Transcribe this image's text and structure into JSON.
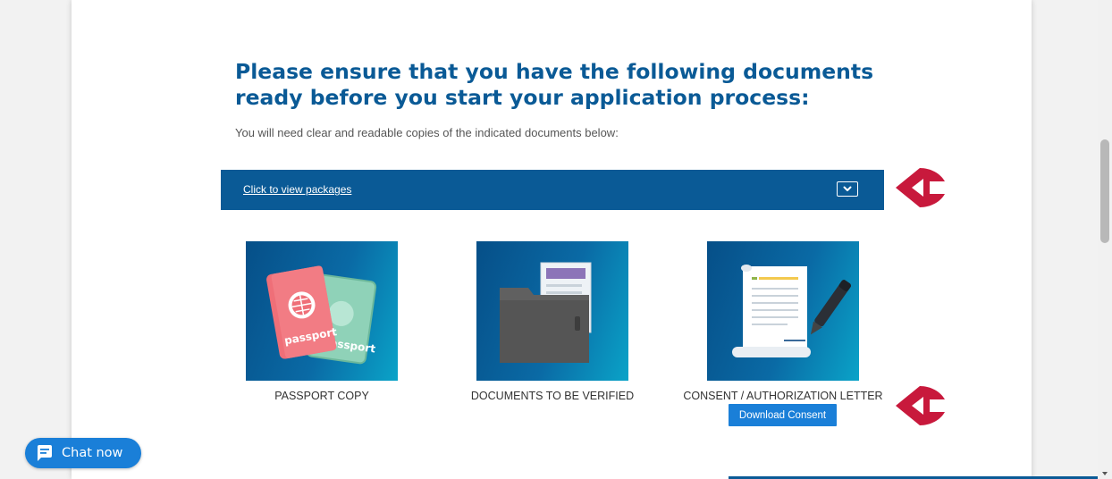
{
  "main": {
    "heading_line1": "Please ensure that you have the following documents",
    "heading_line2": "ready before you start your application process:",
    "subtext": "You will need clear and readable copies of the indicated documents below:"
  },
  "packages": {
    "link_label": "Click to view packages",
    "toggle_icon": "chevron-down-icon"
  },
  "documents": [
    {
      "label": "PASSPORT COPY",
      "icon": "passport-icon"
    },
    {
      "label": "DOCUMENTS TO BE VERIFIED",
      "icon": "folder-documents-icon"
    },
    {
      "label": "CONSENT / AUTHORIZATION LETTER",
      "icon": "consent-letter-icon"
    }
  ],
  "download_button": {
    "label": "Download Consent"
  },
  "chat": {
    "label": "Chat now",
    "icon": "chat-bubble-icon"
  },
  "colors": {
    "brand_blue": "#0a5a96",
    "button_blue": "#1a7fd8",
    "arrow_red": "#c8193c"
  }
}
